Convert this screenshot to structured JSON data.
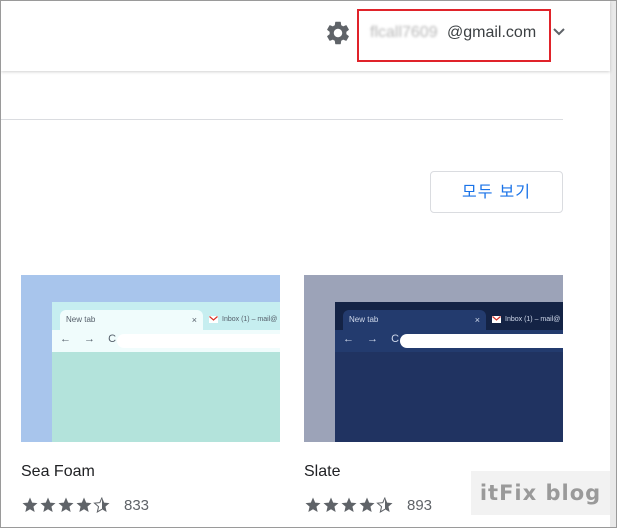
{
  "header": {
    "account_user": "flcall7609",
    "account_domain": "@gmail.com",
    "settings_icon": "gear-icon",
    "menu_icon": "chevron-down-icon"
  },
  "section": {
    "view_all_label": "모두 보기"
  },
  "themes": [
    {
      "name": "Sea Foam",
      "rating": 4.5,
      "rating_count": "833",
      "preview": {
        "tab_label": "New tab",
        "tab_close": "×",
        "other_tab_label": "Inbox (1) – mail@",
        "nav_glyphs": "← → C",
        "colors": {
          "background": "#a8c5ec",
          "frame": "#c6eef0",
          "active_tab": "#f0fcfc",
          "page": "#b3e3db",
          "text": "#555f6a"
        }
      }
    },
    {
      "name": "Slate",
      "rating": 4.5,
      "rating_count": "893",
      "preview": {
        "tab_label": "New tab",
        "tab_close": "×",
        "other_tab_label": "Inbox (1) – mail@",
        "nav_glyphs": "← → C",
        "colors": {
          "background": "#9ca3b8",
          "frame": "#142345",
          "active_tab": "#233b6e",
          "page": "#203361",
          "text": "#cfd8ea"
        }
      }
    }
  ],
  "watermark": "itFix blog",
  "colors": {
    "accent": "#1a73e8",
    "highlight_box": "#e0232a",
    "star": "#5f6368"
  }
}
